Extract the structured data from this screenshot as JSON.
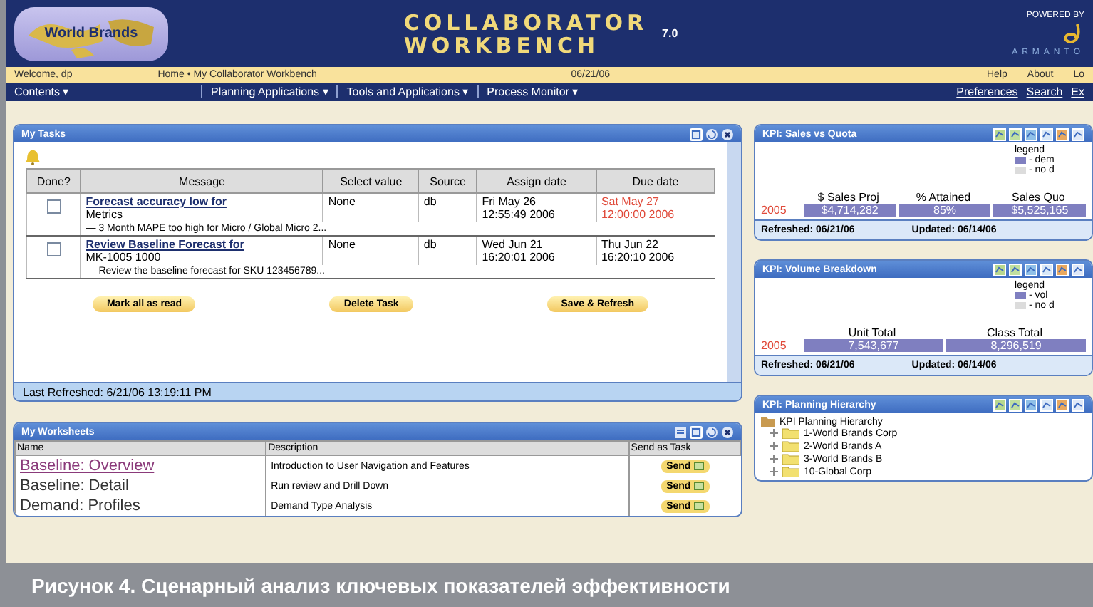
{
  "header": {
    "logo": "World Brands",
    "title_lines": [
      "COLLABORATOR",
      "WORKBENCH"
    ],
    "version": "7.0",
    "powered_by": "POWERED BY",
    "vendor": "ARMANTO"
  },
  "info_bar": {
    "welcome": "Welcome, dp",
    "breadcrumb": "Home • My Collaborator Workbench",
    "date": "06/21/06",
    "links": [
      "Help",
      "About",
      "Lo"
    ]
  },
  "nav": {
    "menus": [
      "Contents ▾",
      "Planning Applications ▾",
      "Tools and Applications ▾",
      "Process Monitor ▾"
    ],
    "links": [
      "Preferences",
      "Search",
      "Ex"
    ]
  },
  "tasks": {
    "title": "My Tasks",
    "columns": [
      "Done?",
      "Message",
      "Select value",
      "Source",
      "Assign date",
      "Due date"
    ],
    "rows": [
      {
        "done": false,
        "message": "Forecast accuracy low for",
        "sub": "Metrics",
        "value": "None",
        "source": "db",
        "assign": [
          "Fri May 26",
          "12:55:49 2006"
        ],
        "due": [
          "Sat May 27",
          "12:00:00 2006"
        ],
        "overdue": true,
        "note": "— 3 Month MAPE too high for Micro / Global Micro 2..."
      },
      {
        "done": false,
        "message": "Review Baseline Forecast for",
        "sub": "MK-1005 1000",
        "value": "None",
        "source": "db",
        "assign": [
          "Wed Jun 21",
          "16:20:01 2006"
        ],
        "due": [
          "Thu Jun 22",
          "16:20:10 2006"
        ],
        "overdue": false,
        "note": "— Review the baseline forecast for SKU 123456789..."
      }
    ],
    "buttons": [
      "Mark all as read",
      "Delete Task",
      "Save & Refresh"
    ],
    "status": "Last Refreshed: 6/21/06 13:19:11 PM"
  },
  "worksheets": {
    "title": "My Worksheets",
    "columns": [
      "Name",
      "Description",
      "Send as Task"
    ],
    "rows": [
      {
        "name": "Baseline: Overview",
        "link": true,
        "description": "Introduction to User Navigation and Features",
        "action": "Send"
      },
      {
        "name": "Baseline: Detail",
        "link": false,
        "description": "Run review and Drill Down",
        "action": "Send"
      },
      {
        "name": "Demand: Profiles",
        "link": false,
        "description": "Demand Type Analysis",
        "action": "Send"
      }
    ]
  },
  "kpis": [
    {
      "title": "KPI: Sales vs Quota",
      "legend_title": "legend",
      "legend": [
        {
          "label": "- dem",
          "color": "#7f7fc0"
        },
        {
          "label": "- no d",
          "color": "#dcdcdc"
        }
      ],
      "columns": [
        "$ Sales Proj",
        "% Attained",
        "Sales Quo"
      ],
      "row_label": "2005",
      "values": [
        "$4,714,282",
        "85%",
        "$5,525,165"
      ],
      "refreshed": "Refreshed: 06/21/06",
      "updated": "Updated: 06/14/06"
    },
    {
      "title": "KPI: Volume Breakdown",
      "legend_title": "legend",
      "legend": [
        {
          "label": "- vol",
          "color": "#7f7fc0"
        },
        {
          "label": "- no d",
          "color": "#dcdcdc"
        }
      ],
      "columns": [
        "Unit Total",
        "Class Total"
      ],
      "row_label": "2005",
      "values": [
        "7,543,677",
        "8,296,519"
      ],
      "refreshed": "Refreshed: 06/21/06",
      "updated": "Updated: 06/14/06"
    }
  ],
  "hierarchy": {
    "title": "KPI: Planning Hierarchy",
    "root": "KPI Planning Hierarchy",
    "children": [
      {
        "label": "1-World Brands Corp"
      },
      {
        "label": "2-World Brands A"
      },
      {
        "label": "3-World Brands B"
      },
      {
        "label": "10-Global Corp"
      }
    ]
  },
  "caption": "Рисунок 4. Сценарный анализ ключевых показателей эффективности"
}
